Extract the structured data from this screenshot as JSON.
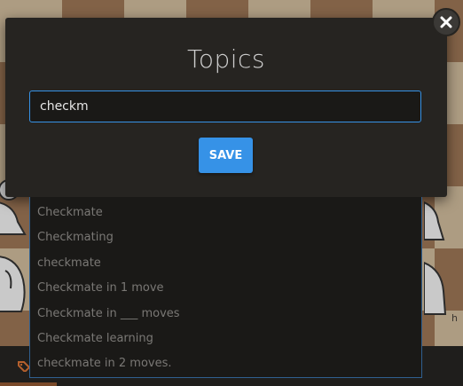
{
  "modal": {
    "title": "Topics",
    "input_value": "checkm",
    "save_label": "SAVE"
  },
  "suggestions": [
    "Checkmate",
    "Checkmating",
    "checkmate",
    "Checkmate in 1 move",
    "Checkmate in ___ moves",
    "Checkmate learning",
    "checkmate in 2 moves."
  ],
  "board": {
    "coordinate": "h"
  },
  "colors": {
    "accent": "#3692e7",
    "modal_bg": "#262421",
    "dropdown_bg": "#1a1917",
    "board_dark": "#b58863",
    "board_light": "#f0d9b5"
  }
}
